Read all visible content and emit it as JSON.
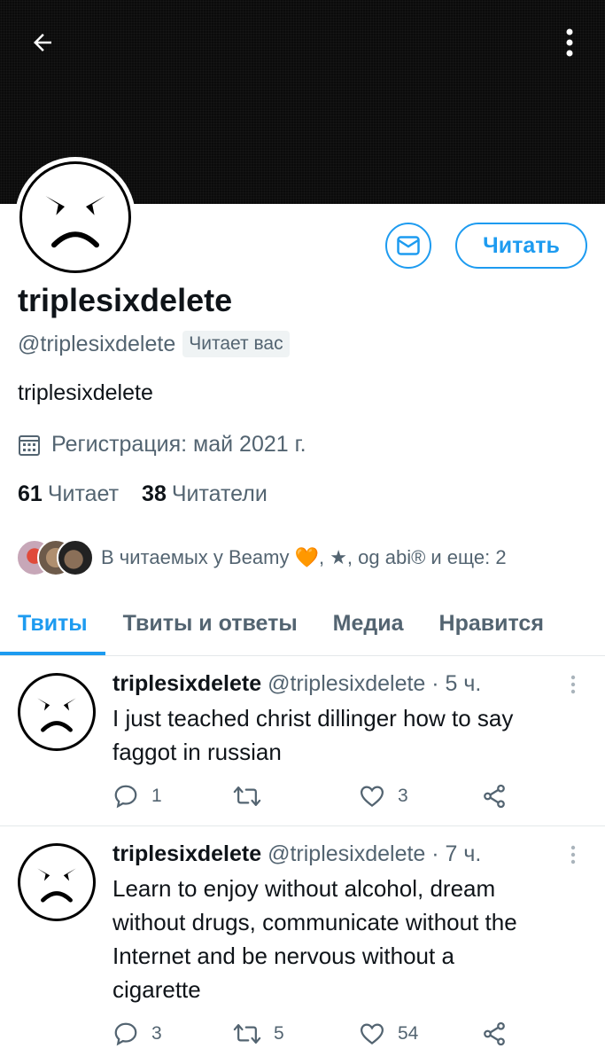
{
  "profile": {
    "display_name": "triplesixdelete",
    "handle": "@triplesixdelete",
    "follows_you": "Читает вас",
    "bio": "triplesixdelete",
    "joined": "Регистрация: май 2021 г.",
    "following_count": "61",
    "following_label": "Читает",
    "followers_count": "38",
    "followers_label": "Читатели",
    "followed_by": "В читаемых у Beamy 🧡, ★, og abi® и еще: 2",
    "follow_button": "Читать"
  },
  "tabs": [
    {
      "label": "Твиты",
      "active": true
    },
    {
      "label": "Твиты и ответы",
      "active": false
    },
    {
      "label": "Медиа",
      "active": false
    },
    {
      "label": "Нравится",
      "active": false
    }
  ],
  "tweets": [
    {
      "name": "triplesixdelete",
      "meta": "@triplesixdelete · 5 ч.",
      "text": "I just teached christ dillinger how to say faggot in russian",
      "replies": "1",
      "retweets": "",
      "likes": "3"
    },
    {
      "name": "triplesixdelete",
      "meta": "@triplesixdelete · 7 ч.",
      "text": "Learn to enjoy without alcohol, dream without drugs, communicate without the Internet and be nervous without a cigarette",
      "replies": "3",
      "retweets": "5",
      "likes": "54"
    }
  ],
  "icons": {
    "back": "arrow-left-icon",
    "more": "more-vertical-icon",
    "message": "envelope-icon",
    "calendar": "calendar-icon",
    "reply": "reply-icon",
    "retweet": "retweet-icon",
    "like": "heart-icon",
    "share": "share-icon"
  },
  "colors": {
    "accent": "#1d9bf0",
    "secondary_text": "#536471",
    "primary_text": "#0f1419"
  }
}
